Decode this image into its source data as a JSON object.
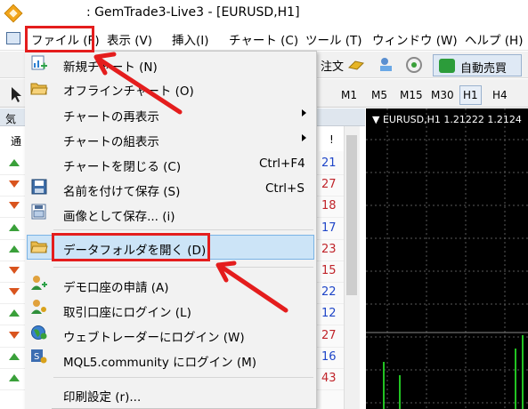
{
  "window": {
    "title": ": GemTrade3-Live3 - [EURUSD,H1]"
  },
  "menubar": {
    "items": [
      {
        "label": "ファイル (F)"
      },
      {
        "label": "表示 (V)"
      },
      {
        "label": "挿入(I)"
      },
      {
        "label": "チャート (C)"
      },
      {
        "label": "ツール (T)"
      },
      {
        "label": "ウィンドウ (W)"
      },
      {
        "label": "ヘルプ (H)"
      }
    ]
  },
  "toolbar": {
    "order_label": "注文",
    "auto_trade_label": "自動売買",
    "timeframes": [
      "M1",
      "M5",
      "M15",
      "M30",
      "H1",
      "H4"
    ],
    "active_timeframe": "H1"
  },
  "market_watch": {
    "title": "気",
    "col_left": "通",
    "col_right": "!",
    "rows": [
      {
        "dir": "up",
        "value": "21",
        "color": "blue"
      },
      {
        "dir": "down",
        "value": "27",
        "color": "red"
      },
      {
        "dir": "down",
        "value": "18",
        "color": "red"
      },
      {
        "dir": "up",
        "value": "17",
        "color": "blue"
      },
      {
        "dir": "up",
        "value": "23",
        "color": "red"
      },
      {
        "dir": "down",
        "value": "15",
        "color": "red"
      },
      {
        "dir": "down",
        "value": "22",
        "color": "blue"
      },
      {
        "dir": "up",
        "value": "12",
        "color": "blue"
      },
      {
        "dir": "down",
        "value": "27",
        "color": "red"
      },
      {
        "dir": "up",
        "value": "16",
        "color": "blue"
      },
      {
        "dir": "up",
        "value": "43",
        "color": "red"
      }
    ]
  },
  "chart": {
    "label": "▼ EURUSD,H1  1.21222 1.2124"
  },
  "file_menu": {
    "items": [
      {
        "label": "新規チャート (N)",
        "icon": "new-chart-icon"
      },
      {
        "label": "オフラインチャート (O)",
        "icon": "open-folder-icon"
      },
      {
        "label": "チャートの再表示",
        "submenu": true
      },
      {
        "label": "チャートの組表示",
        "submenu": true
      },
      {
        "label": "チャートを閉じる (C)",
        "shortcut": "Ctrl+F4"
      },
      {
        "label": "名前を付けて保存 (S)",
        "shortcut": "Ctrl+S",
        "icon": "save-icon"
      },
      {
        "label": "画像として保存... (i)",
        "icon": "save-image-icon"
      },
      {
        "label": "データフォルダを開く (D)",
        "icon": "open-folder-icon",
        "highlighted": true
      },
      {
        "label": "デモ口座の申請 (A)",
        "icon": "add-user-icon"
      },
      {
        "label": "取引口座にログイン (L)",
        "icon": "login-user-icon"
      },
      {
        "label": "ウェブトレーダーにログイン (W)",
        "icon": "globe-icon"
      },
      {
        "label": "MQL5.community にログイン (M)",
        "icon": "mql5-icon"
      },
      {
        "label": "印刷設定 (r)..."
      }
    ]
  },
  "colors": {
    "annotation_red": "#e41d1d",
    "highlight_blue": "#cce4f7",
    "up_green": "#3aa03a",
    "down_orange": "#d9541e",
    "value_blue": "#1f46c8",
    "value_red": "#c0242a"
  }
}
